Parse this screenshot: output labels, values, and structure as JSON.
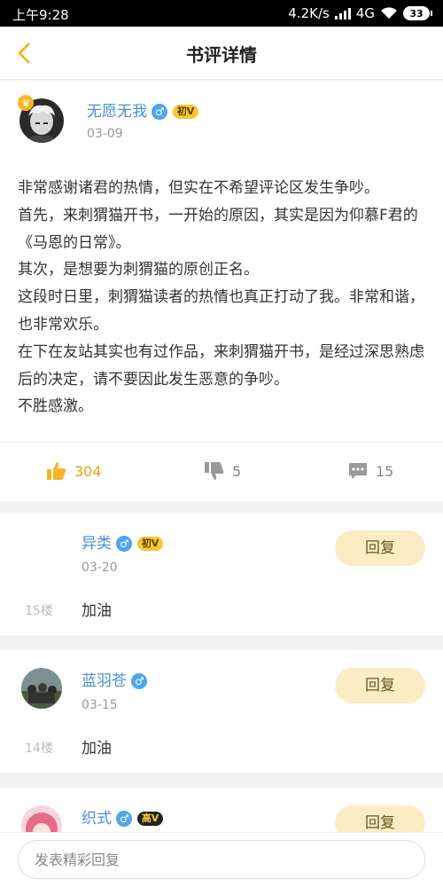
{
  "status_bar": {
    "time": "上午9:28",
    "speed": "4.2K/s",
    "network": "4G",
    "battery": "33"
  },
  "header": {
    "title": "书评详情",
    "back_icon": "chevron-left-icon"
  },
  "review": {
    "author": "无愿无我",
    "gender_symbol": "♂",
    "level_badge": "初V",
    "date": "03-09",
    "paragraphs": [
      "非常感谢诸君的热情，但实在不希望评论区发生争吵。",
      "首先，来刺猬猫开书，一开始的原因，其实是因为仰慕F君的《马恩的日常》。",
      "其次，是想要为刺猬猫的原创正名。",
      "这段时日里，刺猬猫读者的热情也真正打动了我。非常和谐，也非常欢乐。",
      "在下在友站其实也有过作品，来刺猬猫开书，是经过深思熟虑后的决定，请不要因此发生恶意的争吵。",
      "不胜感激。"
    ],
    "likes": "304",
    "dislikes": "5",
    "comments": "15"
  },
  "replies": [
    {
      "name": "异类",
      "gender_symbol": "♂",
      "level_badge": "初V",
      "date": "03-20",
      "floor": "15楼",
      "content": "加油",
      "reply_label": "回复"
    },
    {
      "name": "蓝羽苍",
      "gender_symbol": "♂",
      "level_badge": "",
      "date": "03-15",
      "floor": "14楼",
      "content": "加油",
      "reply_label": "回复"
    },
    {
      "name": "织式",
      "gender_symbol": "♂",
      "level_badge": "高V",
      "reply_label": "回复"
    }
  ],
  "bottom_bar": {
    "placeholder": "发表精彩回复"
  },
  "colors": {
    "accent": "#f5b728",
    "link_blue": "#4a8fcf",
    "like_orange": "#e8a400",
    "reply_button_bg": "#fcecc4"
  }
}
